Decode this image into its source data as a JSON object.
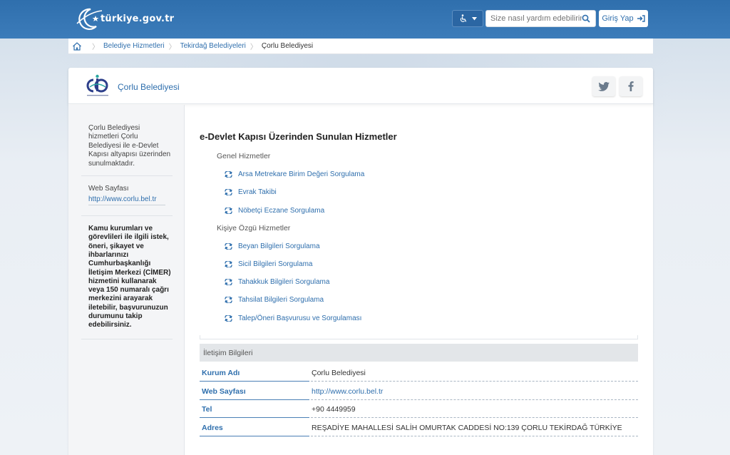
{
  "header": {
    "logo_text": "türkiye.gov.tr",
    "search_placeholder": "Size nasıl yardım edebilirim?",
    "login_label": "Giriş Yap",
    "accessibility_label": "Erişilebilirlik"
  },
  "breadcrumb": {
    "items": [
      "Belediye Hizmetleri",
      "Tekirdağ Belediyeleri",
      "Çorlu Belediyesi"
    ]
  },
  "institution": {
    "name": "Çorlu Belediyesi",
    "logo_caption": "ÇORLU BELEDİYESİ"
  },
  "social": {
    "twitter_icon": "twitter-icon",
    "facebook_icon": "facebook-icon"
  },
  "sidebar": {
    "intro_lines": [
      "Çorlu Belediyesi",
      "hizmetleri Çorlu",
      "Belediyesi ile e-Devlet",
      "Kapısı altyapısı üzerinden",
      "sunulmaktadır."
    ],
    "web_label": "Web Sayfası",
    "web_link": "http://www.corlu.bel.tr",
    "cimer_lines": [
      "Kamu kurumları ve",
      "görevlileri ile ilgili istek,",
      "öneri, şikayet ve",
      "ihbarlarınızı",
      "Cumhurbaşkanlığı",
      "İletişim Merkezi (CİMER)",
      "hizmetini kullanarak",
      "veya 150 numaralı çağrı",
      "merkezini arayarak",
      "iletebilir, başvurunuzun",
      "durumunu takip",
      "edebilirsiniz."
    ]
  },
  "main": {
    "title": "e-Devlet Kapısı Üzerinden Sunulan Hizmetler",
    "groups": [
      {
        "title": "Genel Hizmetler",
        "services": [
          "Arsa Metrekare Birim Değeri Sorgulama",
          "Evrak Takibi",
          "Nöbetçi Eczane Sorgulama"
        ]
      },
      {
        "title": "Kişiye Özgü Hizmetler",
        "services": [
          "Beyan Bilgileri Sorgulama",
          "Sicil Bilgileri Sorgulama",
          "Tahakkuk Bilgileri Sorgulama",
          "Tahsilat Bilgileri Sorgulama",
          "Talep/Öneri Başvurusu ve Sorgulaması"
        ]
      }
    ]
  },
  "contact": {
    "heading": "İletişim Bilgileri",
    "rows": [
      {
        "key": "Kurum Adı",
        "value": "Çorlu Belediyesi"
      },
      {
        "key": "Web Sayfası",
        "value": "http://www.corlu.bel.tr"
      },
      {
        "key": "Tel",
        "value": "+90 4449959"
      },
      {
        "key": "Adres",
        "value": "REŞADİYE MAHALLESİ SALİH OMURTAK CADDESİ NO:139 ÇORLU TEKİRDAĞ TÜRKİYE"
      }
    ]
  },
  "colors": {
    "brand_blue": "#2f6fad",
    "link_blue": "#2f6fad",
    "header_bg": "#3a7ab8"
  }
}
